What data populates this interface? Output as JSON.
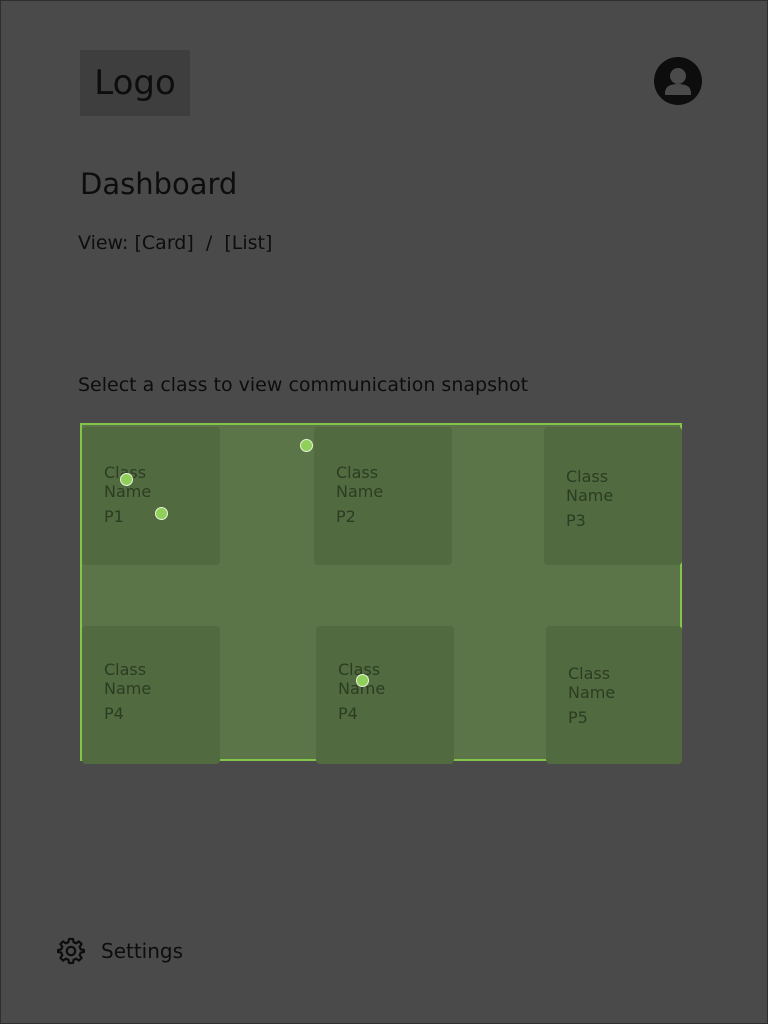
{
  "header": {
    "logo_text": "Logo",
    "avatar_icon": "user-avatar-icon"
  },
  "page": {
    "title": "Dashboard",
    "view_label": "View: ",
    "view_card": "[Card]",
    "view_separator": "  /  ",
    "view_list": "[List]",
    "instruction": "Select a class to view communication snapshot"
  },
  "classes": [
    {
      "name": "Class Name",
      "period": "P1"
    },
    {
      "name": "Class Name",
      "period": "P2"
    },
    {
      "name": "Class Name",
      "period": "P3"
    },
    {
      "name": "Class Name",
      "period": "P4"
    },
    {
      "name": "Class Name",
      "period": "P4"
    },
    {
      "name": "Class Name",
      "period": "P5"
    }
  ],
  "footer": {
    "settings_label": "Settings",
    "settings_icon": "gear-icon"
  },
  "colors": {
    "background": "#4a4a4a",
    "selection_fill": "#5b7548",
    "selection_border": "#84c44a",
    "card_fill": "#526a40",
    "handle": "#8fcf5a"
  }
}
